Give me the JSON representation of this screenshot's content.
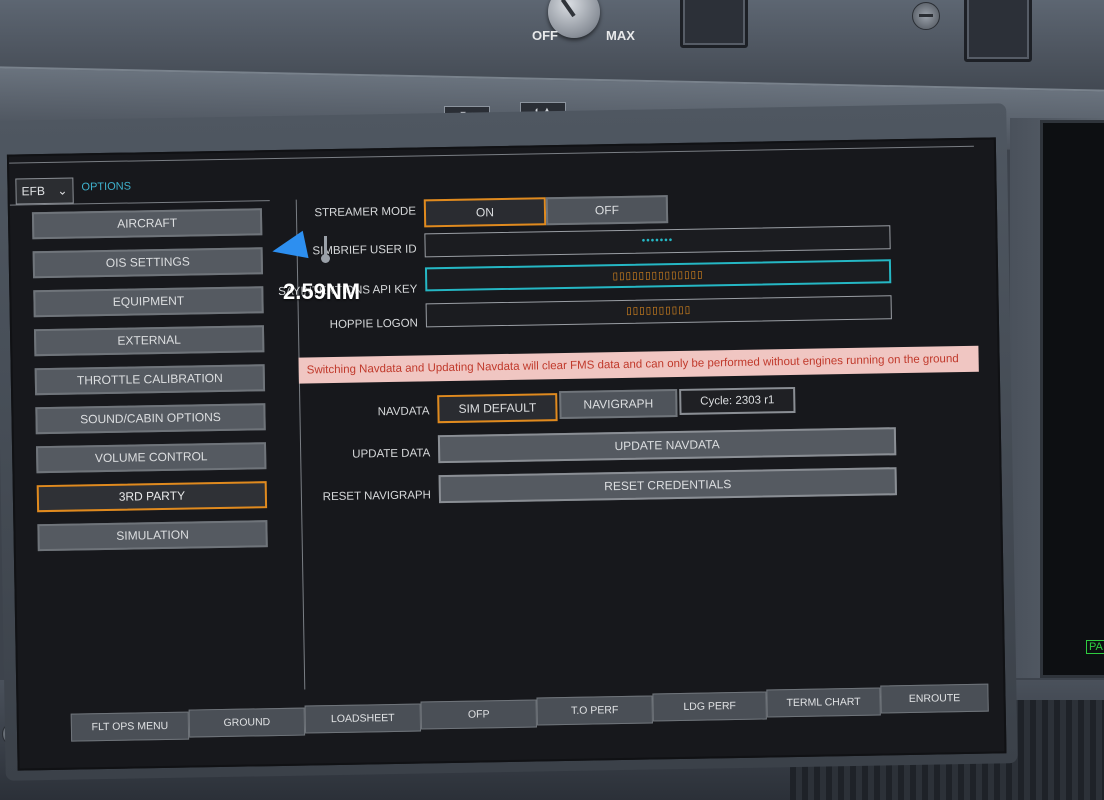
{
  "cockpit": {
    "knob_off_label": "OFF",
    "knob_max_label": "MAX",
    "right_panel_tag": "PA"
  },
  "efb": {
    "app_select": "EFB",
    "section_label": "OPTIONS",
    "sidebar": {
      "items": [
        {
          "label": "AIRCRAFT",
          "active": false
        },
        {
          "label": "OIS SETTINGS",
          "active": false
        },
        {
          "label": "EQUIPMENT",
          "active": false
        },
        {
          "label": "EXTERNAL",
          "active": false
        },
        {
          "label": "THROTTLE CALIBRATION",
          "active": false
        },
        {
          "label": "SOUND/CABIN OPTIONS",
          "active": false
        },
        {
          "label": "VOLUME CONTROL",
          "active": false
        },
        {
          "label": "3RD PARTY",
          "active": true
        },
        {
          "label": "SIMULATION",
          "active": false
        }
      ]
    },
    "form": {
      "streamer_mode": {
        "label": "STREAMER MODE",
        "on": "ON",
        "off": "OFF",
        "selected": "ON"
      },
      "simbrief_user_id": {
        "label": "SIMBRIEF USER ID",
        "value": "•••••••"
      },
      "sayintentions_api_key": {
        "label": "SAYINTENTIONS API KEY",
        "value": "▯▯▯▯▯▯▯▯▯▯▯▯▯▯"
      },
      "hoppie_logon": {
        "label": "HOPPIE LOGON",
        "value": "▯▯▯▯▯▯▯▯▯▯"
      },
      "warning": "Switching Navdata and Updating Navdata will clear FMS data and can only be performed without engines running on the ground",
      "navdata": {
        "label": "NAVDATA",
        "sim_default": "SIM DEFAULT",
        "navigraph": "NAVIGRAPH",
        "cycle": "Cycle: 2303 r1",
        "selected": "SIM DEFAULT"
      },
      "update_data": {
        "label": "UPDATE DATA",
        "button": "UPDATE NAVDATA"
      },
      "reset_navigraph": {
        "label": "RESET NAVIGRAPH",
        "button": "RESET CREDENTIALS"
      }
    },
    "bottom_tabs": [
      "FLT OPS MENU",
      "GROUND",
      "LOADSHEET",
      "OFP",
      "T.O PERF",
      "LDG PERF",
      "TERML CHART",
      "ENROUTE"
    ]
  },
  "overlay": {
    "distance": "2.59NM",
    "marker_color": "#2d8ff0"
  },
  "colors": {
    "accent_orange": "#e08a1e",
    "focus_cyan": "#25b7c4",
    "warning_bg": "#f0c6c2",
    "warning_text": "#c0392b"
  }
}
